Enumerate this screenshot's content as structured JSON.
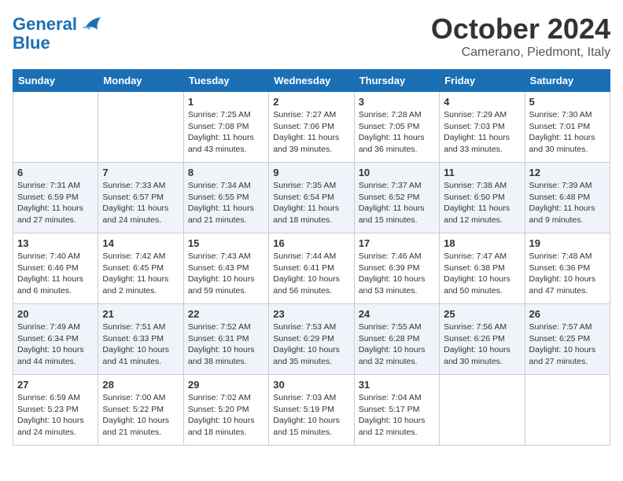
{
  "header": {
    "logo_line1": "General",
    "logo_line2": "Blue",
    "title": "October 2024",
    "subtitle": "Camerano, Piedmont, Italy"
  },
  "days_of_week": [
    "Sunday",
    "Monday",
    "Tuesday",
    "Wednesday",
    "Thursday",
    "Friday",
    "Saturday"
  ],
  "weeks": [
    [
      {
        "day": "",
        "content": ""
      },
      {
        "day": "",
        "content": ""
      },
      {
        "day": "1",
        "content": "Sunrise: 7:25 AM\nSunset: 7:08 PM\nDaylight: 11 hours and 43 minutes."
      },
      {
        "day": "2",
        "content": "Sunrise: 7:27 AM\nSunset: 7:06 PM\nDaylight: 11 hours and 39 minutes."
      },
      {
        "day": "3",
        "content": "Sunrise: 7:28 AM\nSunset: 7:05 PM\nDaylight: 11 hours and 36 minutes."
      },
      {
        "day": "4",
        "content": "Sunrise: 7:29 AM\nSunset: 7:03 PM\nDaylight: 11 hours and 33 minutes."
      },
      {
        "day": "5",
        "content": "Sunrise: 7:30 AM\nSunset: 7:01 PM\nDaylight: 11 hours and 30 minutes."
      }
    ],
    [
      {
        "day": "6",
        "content": "Sunrise: 7:31 AM\nSunset: 6:59 PM\nDaylight: 11 hours and 27 minutes."
      },
      {
        "day": "7",
        "content": "Sunrise: 7:33 AM\nSunset: 6:57 PM\nDaylight: 11 hours and 24 minutes."
      },
      {
        "day": "8",
        "content": "Sunrise: 7:34 AM\nSunset: 6:55 PM\nDaylight: 11 hours and 21 minutes."
      },
      {
        "day": "9",
        "content": "Sunrise: 7:35 AM\nSunset: 6:54 PM\nDaylight: 11 hours and 18 minutes."
      },
      {
        "day": "10",
        "content": "Sunrise: 7:37 AM\nSunset: 6:52 PM\nDaylight: 11 hours and 15 minutes."
      },
      {
        "day": "11",
        "content": "Sunrise: 7:38 AM\nSunset: 6:50 PM\nDaylight: 11 hours and 12 minutes."
      },
      {
        "day": "12",
        "content": "Sunrise: 7:39 AM\nSunset: 6:48 PM\nDaylight: 11 hours and 9 minutes."
      }
    ],
    [
      {
        "day": "13",
        "content": "Sunrise: 7:40 AM\nSunset: 6:46 PM\nDaylight: 11 hours and 6 minutes."
      },
      {
        "day": "14",
        "content": "Sunrise: 7:42 AM\nSunset: 6:45 PM\nDaylight: 11 hours and 2 minutes."
      },
      {
        "day": "15",
        "content": "Sunrise: 7:43 AM\nSunset: 6:43 PM\nDaylight: 10 hours and 59 minutes."
      },
      {
        "day": "16",
        "content": "Sunrise: 7:44 AM\nSunset: 6:41 PM\nDaylight: 10 hours and 56 minutes."
      },
      {
        "day": "17",
        "content": "Sunrise: 7:46 AM\nSunset: 6:39 PM\nDaylight: 10 hours and 53 minutes."
      },
      {
        "day": "18",
        "content": "Sunrise: 7:47 AM\nSunset: 6:38 PM\nDaylight: 10 hours and 50 minutes."
      },
      {
        "day": "19",
        "content": "Sunrise: 7:48 AM\nSunset: 6:36 PM\nDaylight: 10 hours and 47 minutes."
      }
    ],
    [
      {
        "day": "20",
        "content": "Sunrise: 7:49 AM\nSunset: 6:34 PM\nDaylight: 10 hours and 44 minutes."
      },
      {
        "day": "21",
        "content": "Sunrise: 7:51 AM\nSunset: 6:33 PM\nDaylight: 10 hours and 41 minutes."
      },
      {
        "day": "22",
        "content": "Sunrise: 7:52 AM\nSunset: 6:31 PM\nDaylight: 10 hours and 38 minutes."
      },
      {
        "day": "23",
        "content": "Sunrise: 7:53 AM\nSunset: 6:29 PM\nDaylight: 10 hours and 35 minutes."
      },
      {
        "day": "24",
        "content": "Sunrise: 7:55 AM\nSunset: 6:28 PM\nDaylight: 10 hours and 32 minutes."
      },
      {
        "day": "25",
        "content": "Sunrise: 7:56 AM\nSunset: 6:26 PM\nDaylight: 10 hours and 30 minutes."
      },
      {
        "day": "26",
        "content": "Sunrise: 7:57 AM\nSunset: 6:25 PM\nDaylight: 10 hours and 27 minutes."
      }
    ],
    [
      {
        "day": "27",
        "content": "Sunrise: 6:59 AM\nSunset: 5:23 PM\nDaylight: 10 hours and 24 minutes."
      },
      {
        "day": "28",
        "content": "Sunrise: 7:00 AM\nSunset: 5:22 PM\nDaylight: 10 hours and 21 minutes."
      },
      {
        "day": "29",
        "content": "Sunrise: 7:02 AM\nSunset: 5:20 PM\nDaylight: 10 hours and 18 minutes."
      },
      {
        "day": "30",
        "content": "Sunrise: 7:03 AM\nSunset: 5:19 PM\nDaylight: 10 hours and 15 minutes."
      },
      {
        "day": "31",
        "content": "Sunrise: 7:04 AM\nSunset: 5:17 PM\nDaylight: 10 hours and 12 minutes."
      },
      {
        "day": "",
        "content": ""
      },
      {
        "day": "",
        "content": ""
      }
    ]
  ]
}
